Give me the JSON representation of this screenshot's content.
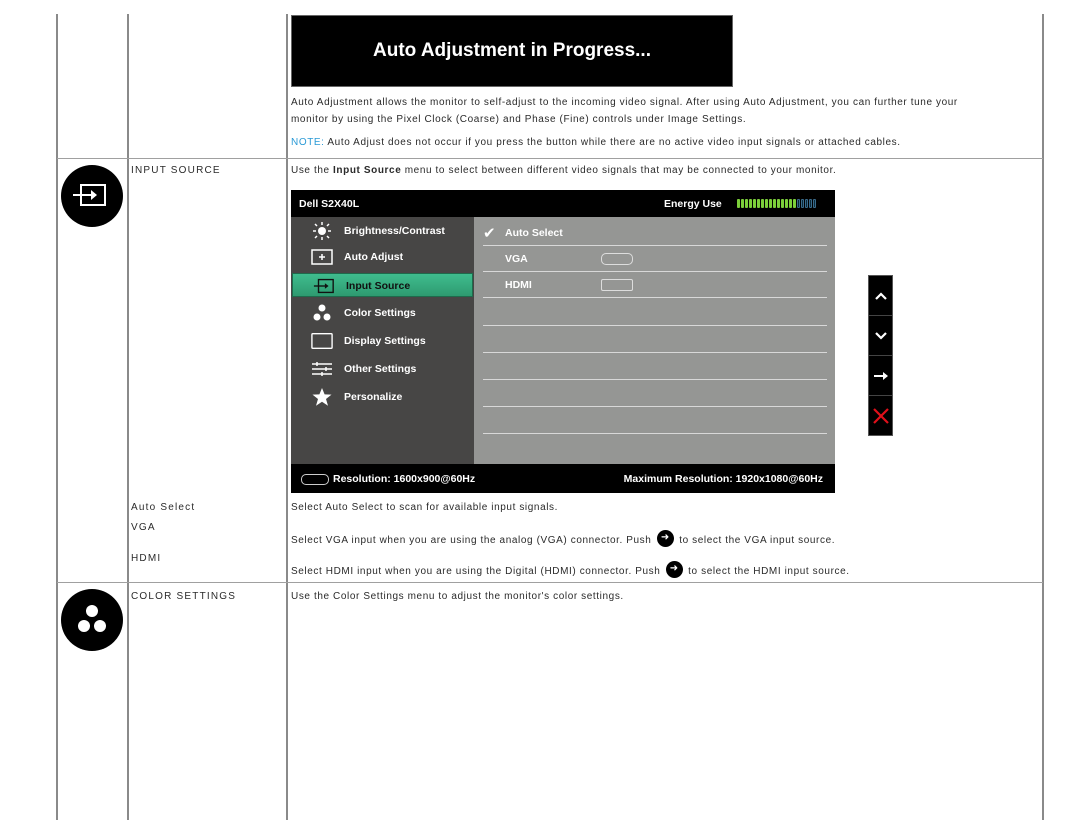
{
  "auto_adjust": {
    "banner_text": "Auto Adjustment in Progress...",
    "description_line1": "Auto Adjustment allows the monitor to self-adjust to the incoming video signal. After using Auto Adjustment, you can further tune your",
    "description_line2": "monitor by using the Pixel Clock (Coarse) and Phase (Fine) controls under Image Settings.",
    "note_label": "NOTE:",
    "note_text": " Auto Adjust does not occur if you press the button while there are no active video input signals or attached cables."
  },
  "input_source": {
    "icon": "input-source-icon",
    "heading": "INPUT SOURCE",
    "intro_prefix": "Use the ",
    "intro_bold": "Input Source",
    "intro_suffix": " menu to select between different video signals that may be connected to your monitor.",
    "options": [
      {
        "label": "Auto Select",
        "description": "Select Auto Select to scan for available input signals."
      },
      {
        "label": "VGA",
        "description_before": "Select VGA input when you are using the analog (VGA) connector. Push ",
        "push_icon": "arrow-right-icon",
        "description_after": " to select the VGA input source."
      },
      {
        "label": "HDMI",
        "description_before": "Select HDMI input when you are using the Digital (HDMI) connector. Push ",
        "push_icon": "arrow-right-icon",
        "description_after": " to select the HDMI input source."
      }
    ]
  },
  "osd": {
    "model": "Dell S2X40L",
    "energy_label": "Energy Use",
    "energy_level": {
      "filled": 15,
      "total": 20
    },
    "energy_colors": {
      "filled": "#7ccf3a",
      "empty": "#0a2a3a"
    },
    "accent_color": "#34ad7f",
    "menu": [
      {
        "icon": "brightness-icon",
        "label": "Brightness/Contrast",
        "active": false
      },
      {
        "icon": "auto-adjust-icon",
        "label": "Auto Adjust",
        "active": false
      },
      {
        "icon": "input-source-icon",
        "label": "Input Source",
        "active": true
      },
      {
        "icon": "color-settings-icon",
        "label": "Color Settings",
        "active": false
      },
      {
        "icon": "display-settings-icon",
        "label": "Display Settings",
        "active": false
      },
      {
        "icon": "other-settings-icon",
        "label": "Other Settings",
        "active": false
      },
      {
        "icon": "personalize-star-icon",
        "label": "Personalize",
        "active": false
      }
    ],
    "submenu": [
      {
        "label": "Auto Select",
        "checked": true,
        "connector": null
      },
      {
        "label": "VGA",
        "checked": false,
        "connector": "vga-connector-icon"
      },
      {
        "label": "HDMI",
        "checked": false,
        "connector": "hdmi-connector-icon"
      }
    ],
    "resolution": "Resolution: 1600x900@60Hz",
    "max_resolution": "Maximum Resolution: 1920x1080@60Hz",
    "nav_buttons": [
      {
        "icon": "chevron-up-icon",
        "glyph": "^"
      },
      {
        "icon": "chevron-down-icon",
        "glyph": "v"
      },
      {
        "icon": "arrow-right-icon",
        "glyph": "→"
      },
      {
        "icon": "close-icon",
        "glyph": "✕"
      }
    ],
    "close_color": "#e0101a"
  },
  "color_settings": {
    "icon": "color-settings-icon",
    "heading": "COLOR SETTINGS",
    "description": "Use the Color Settings menu to adjust the monitor's color settings."
  }
}
